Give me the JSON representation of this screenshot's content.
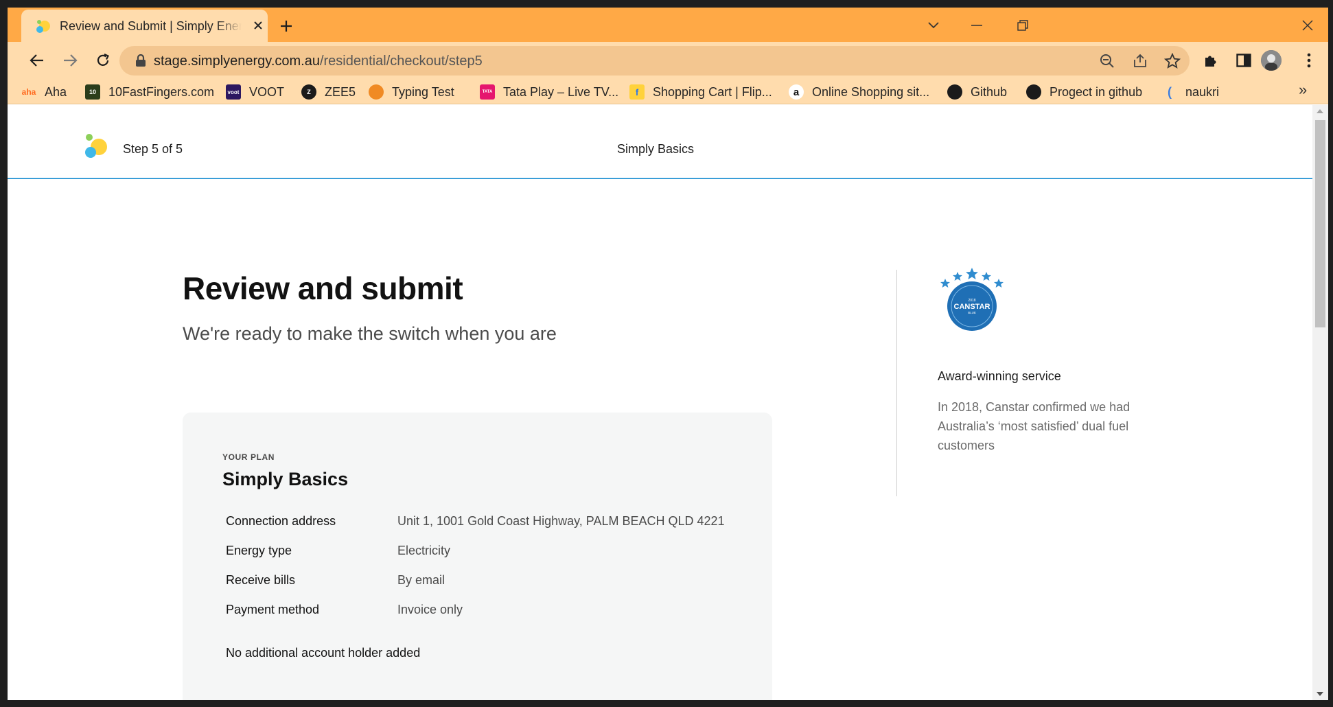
{
  "browser": {
    "tab": {
      "title": "Review and Submit | Simply Energy",
      "favicon": "simply-energy-logo"
    },
    "url": {
      "host": "stage.simplyenergy.com.au",
      "path": "/residential/checkout/step5"
    },
    "bookmarks": [
      {
        "label": "Aha",
        "icon": "aha-icon"
      },
      {
        "label": "10FastFingers.com",
        "icon": "10fastfingers-icon"
      },
      {
        "label": "VOOT",
        "icon": "voot-icon"
      },
      {
        "label": "ZEE5",
        "icon": "zee5-icon"
      },
      {
        "label": "Typing Test",
        "icon": "typing-test-icon"
      },
      {
        "label": "Tata Play – Live TV...",
        "icon": "tata-play-icon"
      },
      {
        "label": "Shopping Cart | Flip...",
        "icon": "flipkart-icon"
      },
      {
        "label": "Online Shopping sit...",
        "icon": "amazon-icon"
      },
      {
        "label": "Github",
        "icon": "github-icon"
      },
      {
        "label": "Progect in github",
        "icon": "github-icon"
      },
      {
        "label": "naukri",
        "icon": "naukri-icon"
      }
    ],
    "colors": {
      "frame": "#ffa946",
      "toolbar": "#ffdcad",
      "omnibox": "#f3c690"
    }
  },
  "header": {
    "step": "Step 5 of 5",
    "plan_name": "Simply Basics"
  },
  "main": {
    "title": "Review and submit",
    "subtitle": "We're ready to make the switch when you are",
    "plan_card": {
      "eyebrow": "YOUR PLAN",
      "title": "Simply Basics",
      "rows": [
        {
          "label": "Connection address",
          "value": "Unit 1, 1001 Gold Coast Highway, PALM BEACH QLD 4221"
        },
        {
          "label": "Energy type",
          "value": "Electricity"
        },
        {
          "label": "Receive bills",
          "value": "By email"
        },
        {
          "label": "Payment method",
          "value": "Invoice only"
        }
      ],
      "note": "No additional account holder added"
    }
  },
  "sidebar": {
    "badge": {
      "line1": "CANSTAR",
      "year": "2018",
      "sub": "BLUE"
    },
    "award_title": "Award-winning service",
    "award_text": "In 2018, Canstar confirmed we had Australia’s ‘most satisfied’ dual fuel customers"
  },
  "accent_color": "#3a9ed8"
}
